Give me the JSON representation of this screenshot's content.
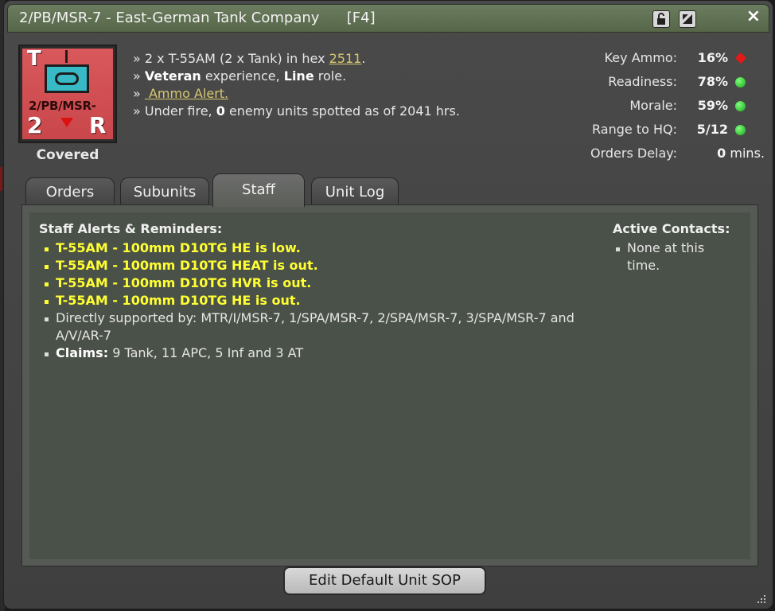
{
  "window": {
    "title": "2/PB/MSR-7 - East-German Tank Company",
    "hotkey": "[F4]",
    "close_glyph": "×"
  },
  "unit_card": {
    "top_letter": "T",
    "designation": "2/PB/MSR-",
    "bottom_left": "2",
    "bottom_right": "R",
    "status": "Covered"
  },
  "info": {
    "line1_prefix": "» 2 x T-55AM (2 x Tank) in hex ",
    "hex": "2511",
    "line1_suffix": ".",
    "line2_prefix": "» ",
    "experience": "Veteran",
    "line2_mid": " experience, ",
    "role": "Line",
    "line2_suffix": " role.",
    "line3_prefix": "» ",
    "ammo_alert": " Ammo Alert.",
    "line4_prefix": "» Under fire, ",
    "enemy_count": "0",
    "line4_suffix": " enemy units spotted as of 2041 hrs."
  },
  "stats": [
    {
      "label": "Key Ammo:",
      "value": "16%",
      "indicator": "red-diamond",
      "color": "#e31919"
    },
    {
      "label": "Readiness:",
      "value": "78%",
      "indicator": "green-dot",
      "color": "#1aa51a"
    },
    {
      "label": "Morale:",
      "value": "59%",
      "indicator": "green-dot",
      "color": "#1aa51a"
    },
    {
      "label": "Range to HQ:",
      "value": "5/12",
      "indicator": "green-dot",
      "color": "#1aa51a"
    },
    {
      "label": "Orders Delay:",
      "value": "0",
      "unit": " mins."
    }
  ],
  "tabs": [
    "Orders",
    "Subunits",
    "Staff",
    "Unit Log"
  ],
  "active_tab": "Staff",
  "staff": {
    "alerts_title": "Staff Alerts & Reminders:",
    "alerts": [
      "T-55AM - 100mm D10TG HE is low.",
      "T-55AM - 100mm D10TG HEAT is out.",
      "T-55AM - 100mm D10TG HVR is out.",
      "T-55AM - 100mm D10TG HE is out."
    ],
    "support": "Directly supported by: MTR/I/MSR-7, 1/SPA/MSR-7, 2/SPA/MSR-7, 3/SPA/MSR-7 and A/V/AR-7",
    "claims_label": "Claims:",
    "claims_value": " 9 Tank, 11 APC, 5 Inf and 3 AT",
    "contacts_title": "Active Contacts:",
    "contacts": [
      "None at this time."
    ]
  },
  "buttons": {
    "sop": "Edit Default Unit SOP"
  },
  "icons": [
    "lock-open-icon",
    "restore-icon",
    "close-icon",
    "resize-grip-icon"
  ],
  "colors": {
    "titlebar": "#607054",
    "warning_text": "#ffff33",
    "link": "#d6c76e",
    "unit_red": "#d04f53"
  }
}
